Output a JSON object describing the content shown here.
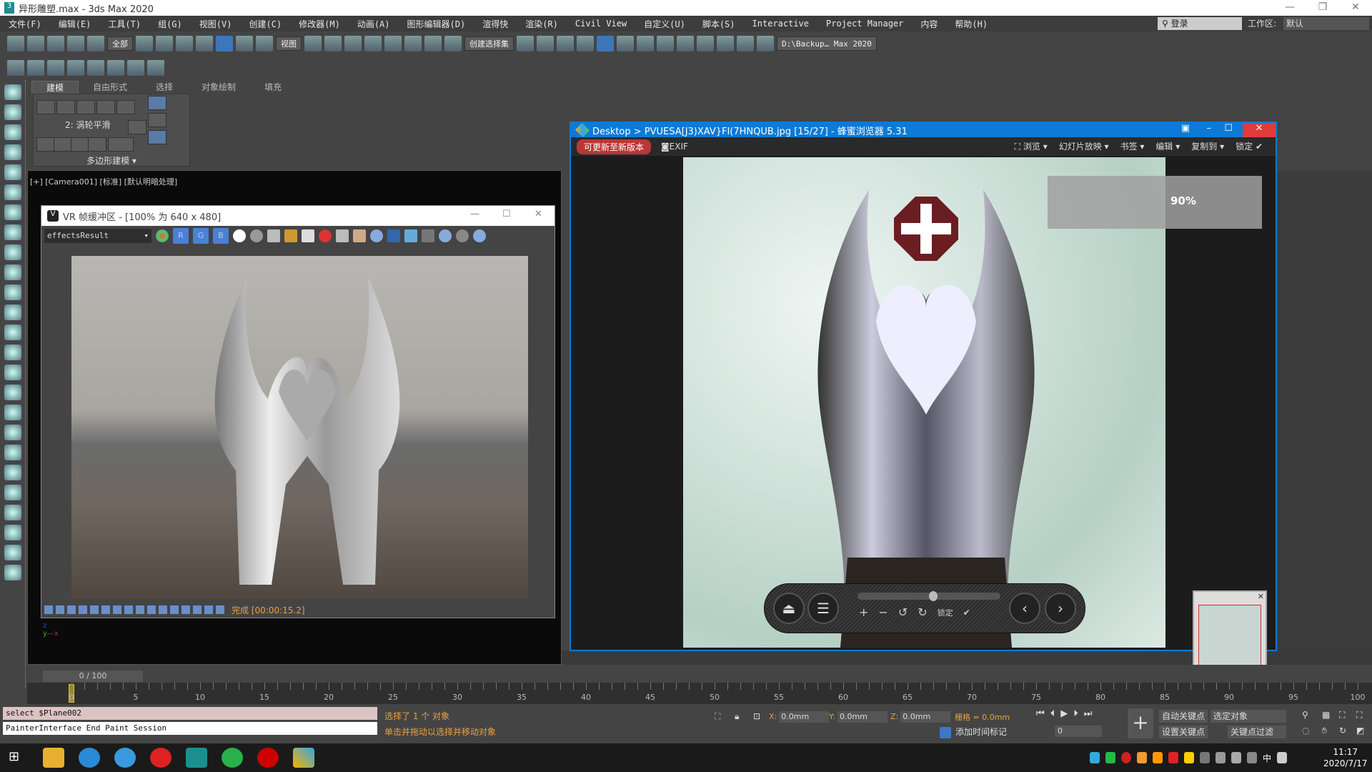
{
  "app": {
    "title": "异形雕塑.max - 3ds Max 2020",
    "window_controls": [
      "—",
      "❐",
      "✕"
    ]
  },
  "menu": [
    "文件(F)",
    "编辑(E)",
    "工具(T)",
    "组(G)",
    "视图(V)",
    "创建(C)",
    "修改器(M)",
    "动画(A)",
    "图形编辑器(D)",
    "渲得快",
    "渲染(R)",
    "Civil View",
    "自定义(U)",
    "脚本(S)",
    "Interactive",
    "Project Manager",
    "内容",
    "帮助(H)"
  ],
  "login": "登录",
  "workspace": {
    "label": "工作区:",
    "value": "默认"
  },
  "toolbar": {
    "selection_filter": "全部",
    "ref_coord": "视图",
    "named_selection": "创建选择集",
    "project_path": "D:\\Backup… Max 2020",
    "icons": [
      "undo-icon",
      "redo-icon",
      "link-icon",
      "unlink-icon",
      "bind-spacewarp-icon",
      "select-object-icon",
      "select-by-name-icon",
      "rect-selection-icon",
      "window-crossing-icon",
      "move-icon",
      "rotate-icon",
      "scale-icon",
      "place-icon",
      "pivot-icon",
      "keyboard-shortcut-icon",
      "snap-3d-icon",
      "angle-snap-icon",
      "percent-snap-icon",
      "spinner-snap-icon",
      "edit-named-sel-icon",
      "mirror-icon",
      "align-icon",
      "scene-explorer-icon",
      "layer-explorer-icon",
      "ribbon-toggle-icon",
      "curve-editor-icon",
      "schematic-icon",
      "material-editor-icon",
      "render-setup-icon",
      "rendered-frame-icon",
      "render-icon",
      "render-iterative-icon",
      "teapot-icon"
    ]
  },
  "ribbon": {
    "tabs": [
      "建模",
      "自由形式",
      "选择",
      "对象绘制",
      "填充"
    ],
    "active_tab": 0,
    "smoothing": "2: 涡轮平滑",
    "panel_label": "多边形建模"
  },
  "viewport": {
    "label": "[+] [Camera001] [标准] [默认明暗处理]"
  },
  "vfb": {
    "title": "VR 帧缓冲区 - [100% 为 640 x 480]",
    "channel": "effectsResult",
    "channels": [
      "R",
      "G",
      "B"
    ],
    "status": "完成 [00:00:15.2]"
  },
  "time_slider": "0 / 100",
  "timeline": {
    "ticks": [
      0,
      5,
      10,
      15,
      20,
      25,
      30,
      35,
      40,
      45,
      50,
      55,
      60,
      65,
      70,
      75,
      80,
      85,
      90,
      95,
      100
    ],
    "current": 0
  },
  "viewer": {
    "title": "Desktop > PVUESA[J3)XAV}FI(7HNQUB.jpg [15/27] - 蜂蜜浏览器 5.31",
    "update_button": "可更新至新版本",
    "exif": "EXIF",
    "menu": [
      "浏览 ▾",
      "幻灯片放映 ▾",
      "书签 ▾",
      "编辑 ▾",
      "复制到 ▾",
      "锁定"
    ],
    "zoom_percent": "90%",
    "lock_label": "锁定",
    "accent": "#0c7ad6"
  },
  "status": {
    "maxscript_input": "select $Plane002",
    "maxscript_output": "PainterInterface End Paint Session",
    "selected": "选择了 1 个 对象",
    "prompt": "单击并拖动以选择并移动对象",
    "x": "0.0mm",
    "y": "0.0mm",
    "z": "0.0mm",
    "grid": "栅格 = 0.0mm",
    "add_time_tag": "添加时间标记",
    "frame": "0",
    "auto_key": "自动关键点",
    "set_key": "设置关键点",
    "key_target": "选定对象",
    "key_filters": "关键点过滤器..."
  },
  "taskbar": {
    "time": "11:17",
    "date": "2020/7/17",
    "ime": "中"
  }
}
